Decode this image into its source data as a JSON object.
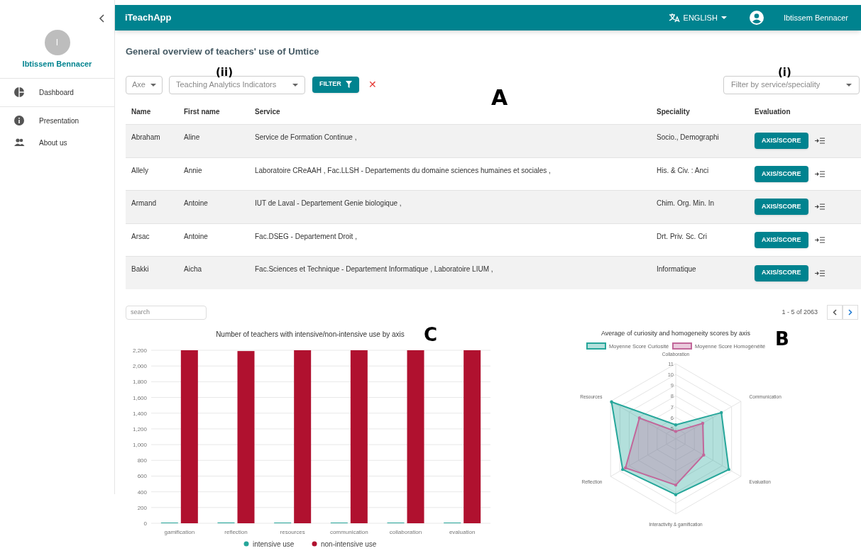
{
  "sidebar": {
    "user": {
      "initial": "I",
      "name": "Ibtissem Bennacer"
    },
    "items": [
      {
        "label": "Dashboard",
        "selected": false
      },
      {
        "label": "Presentation",
        "selected": false
      },
      {
        "label": "About us",
        "selected": false
      }
    ]
  },
  "header": {
    "title": "iTeachApp",
    "language": "ENGLISH",
    "user": "Ibtissem Bennacer"
  },
  "page_title": "General overview of teachers' use of Umtice",
  "annotations": {
    "filters_left": "(ii)",
    "filters_right": "(i)",
    "table": "A",
    "radar": "B",
    "bars": "C"
  },
  "filters": {
    "axe": {
      "placeholder": "Axe"
    },
    "indicators": {
      "placeholder": "Teaching Analytics Indicators"
    },
    "filter_button": "FILTER",
    "clear": "✕",
    "service": {
      "placeholder": "Filter by service/speciality"
    }
  },
  "table": {
    "columns": [
      "Name",
      "First name",
      "Service",
      "Speciality",
      "Evaluation"
    ],
    "rows": [
      {
        "name": "Abraham",
        "first_name": "Aline",
        "service": "Service de Formation Continue ,",
        "speciality": "Socio., Demographi",
        "action": "AXIS/SCORE"
      },
      {
        "name": "Allely",
        "first_name": "Annie",
        "service": "Laboratoire CReAAH , Fac.LLSH - Departements du domaine sciences humaines et sociales ,",
        "speciality": "His. & Civ. : Anci",
        "action": "AXIS/SCORE"
      },
      {
        "name": "Armand",
        "first_name": "Antoine",
        "service": "IUT de Laval - Departement Genie biologique ,",
        "speciality": "Chim. Org. Min. In",
        "action": "AXIS/SCORE"
      },
      {
        "name": "Arsac",
        "first_name": "Antoine",
        "service": "Fac.DSEG - Departement Droit ,",
        "speciality": "Drt. Priv. Sc. Cri",
        "action": "AXIS/SCORE"
      },
      {
        "name": "Bakki",
        "first_name": "Aicha",
        "service": "Fac.Sciences et Technique - Departement Informatique , Laboratoire LIUM ,",
        "speciality": "Informatique",
        "action": "AXIS/SCORE"
      }
    ],
    "search": {
      "placeholder": "search"
    },
    "pagination": "1 - 5 of 2063"
  },
  "bar_chart": {
    "chart_data": {
      "type": "bar",
      "title": "Number of teachers with intensive/non-intensive use by axis",
      "categories": [
        "gamification",
        "reflection",
        "resources",
        "communication",
        "collaboration",
        "evaluation"
      ],
      "series": [
        {
          "name": "intensive use",
          "color": "#26a69a",
          "values": [
            0,
            10,
            0,
            0,
            0,
            0
          ]
        },
        {
          "name": "non-intensive use",
          "color": "#b0112f",
          "values": [
            2200,
            2190,
            2200,
            2200,
            2200,
            2200
          ]
        }
      ],
      "ylim": [
        0,
        2200
      ],
      "yticks": [
        0,
        200,
        400,
        600,
        800,
        {
          "value": 1000,
          "label": "1,000"
        },
        {
          "value": 1200,
          "label": "1,200"
        },
        {
          "value": 1400,
          "label": "1,400"
        },
        {
          "value": 1600,
          "label": "1,600"
        },
        {
          "value": 1800,
          "label": "1,800"
        },
        {
          "value": 2000,
          "label": "2,000"
        },
        {
          "value": 2200,
          "label": "2,200"
        }
      ],
      "grid": true,
      "legend": "bottom"
    }
  },
  "radar_chart": {
    "title": "Average of curiosity and homogeneity scores by axis",
    "legend": [
      {
        "name": "Moyenne Score Curiosité",
        "color": "#26a69a"
      },
      {
        "name": "Moyenne Score Homogénéité",
        "color": "#c2679a"
      }
    ],
    "axis_labels": [
      "Collaboration",
      "Communication",
      "Evaluation",
      "Interactivity & gamification",
      "Reflection",
      "Resources"
    ],
    "scale_labels": [
      "11",
      "10",
      "9",
      "8",
      "7",
      "6",
      "5"
    ]
  }
}
